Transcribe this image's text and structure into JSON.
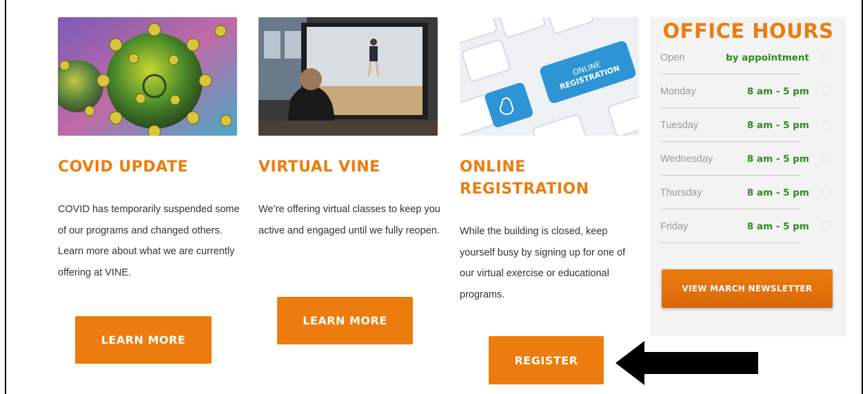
{
  "cards": [
    {
      "title": "COVID UPDATE",
      "text": "COVID has temporarily suspended some of our programs and changed others.  Learn more about what we are currently offering at VINE.",
      "button": "LEARN MORE",
      "image": "coronavirus-image"
    },
    {
      "title": "VIRTUAL VINE",
      "text": "We’re offering virtual classes to keep you active and engaged until we fully reopen.",
      "button": "LEARN MORE",
      "image": "virtual-class-image"
    },
    {
      "title": "ONLINE REGISTRATION",
      "text": "While the building is closed, keep yourself busy by signing up for one of our virtual exercise or educational programs.",
      "button": "REGISTER",
      "image": "online-registration-keyboard-image",
      "image_text": "ONLINE REGISTRATION"
    }
  ],
  "office_hours": {
    "title": "OFFICE HOURS",
    "rows": [
      {
        "day": "Open",
        "time": "by appointment"
      },
      {
        "day": "Monday",
        "time": "8 am - 5 pm"
      },
      {
        "day": "Tuesday",
        "time": "8 am - 5 pm"
      },
      {
        "day": "Wednesday",
        "time": "8 am - 5 pm"
      },
      {
        "day": "Thursday",
        "time": "8 am - 5 pm"
      },
      {
        "day": "Friday",
        "time": "8 am - 5 pm"
      }
    ],
    "newsletter_button": "VIEW MARCH NEWSLETTER"
  },
  "colors": {
    "accent": "#ec7c0e",
    "hours_green": "#2e8b1e",
    "panel_bg": "#f3f3f3"
  },
  "annotation": {
    "icon": "arrow-left-icon",
    "color": "#000000"
  }
}
